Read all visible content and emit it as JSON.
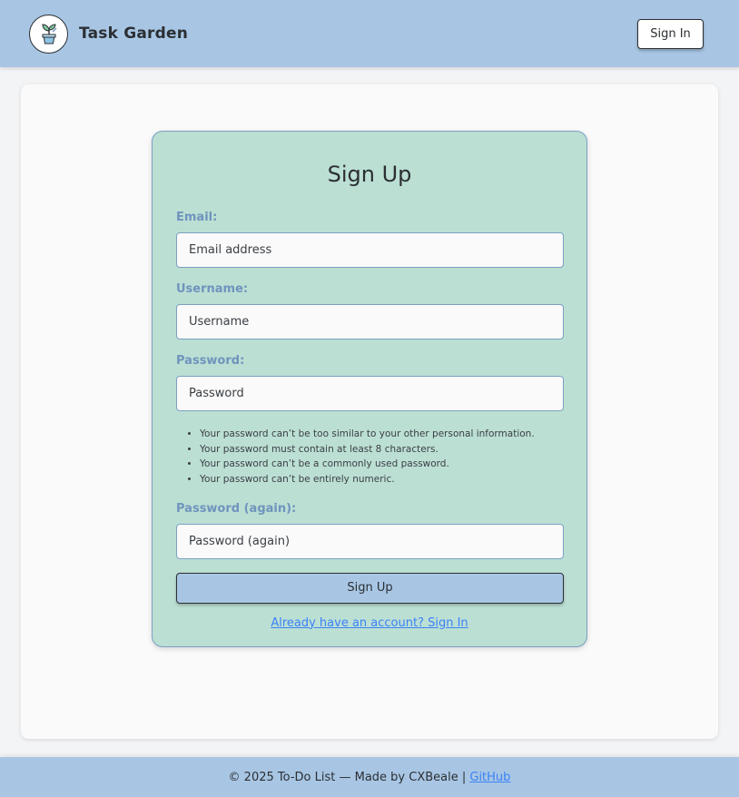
{
  "navbar": {
    "brand": "Task Garden",
    "logo_icon": "plant-pot-icon",
    "sign_in_label": "Sign In"
  },
  "form": {
    "title": "Sign Up",
    "email": {
      "label": "Email:",
      "placeholder": "Email address",
      "value": ""
    },
    "username": {
      "label": "Username:",
      "placeholder": "Username",
      "value": ""
    },
    "password": {
      "label": "Password:",
      "placeholder": "Password",
      "value": ""
    },
    "password_help": [
      "Your password can’t be too similar to your other personal information.",
      "Your password must contain at least 8 characters.",
      "Your password can’t be a commonly used password.",
      "Your password can’t be entirely numeric."
    ],
    "password_again": {
      "label": "Password (again):",
      "placeholder": "Password (again)",
      "value": ""
    },
    "submit_label": "Sign Up",
    "signin_link": "Already have an account? Sign In"
  },
  "footer": {
    "text": "© 2025 To-Do List — Made by CXBeale |",
    "link": "GitHub"
  },
  "colors": {
    "navbar_bg": "#a8c6e4",
    "card_bg": "#bcdfd4",
    "label": "#6f94bd",
    "link": "#3b82f6"
  }
}
